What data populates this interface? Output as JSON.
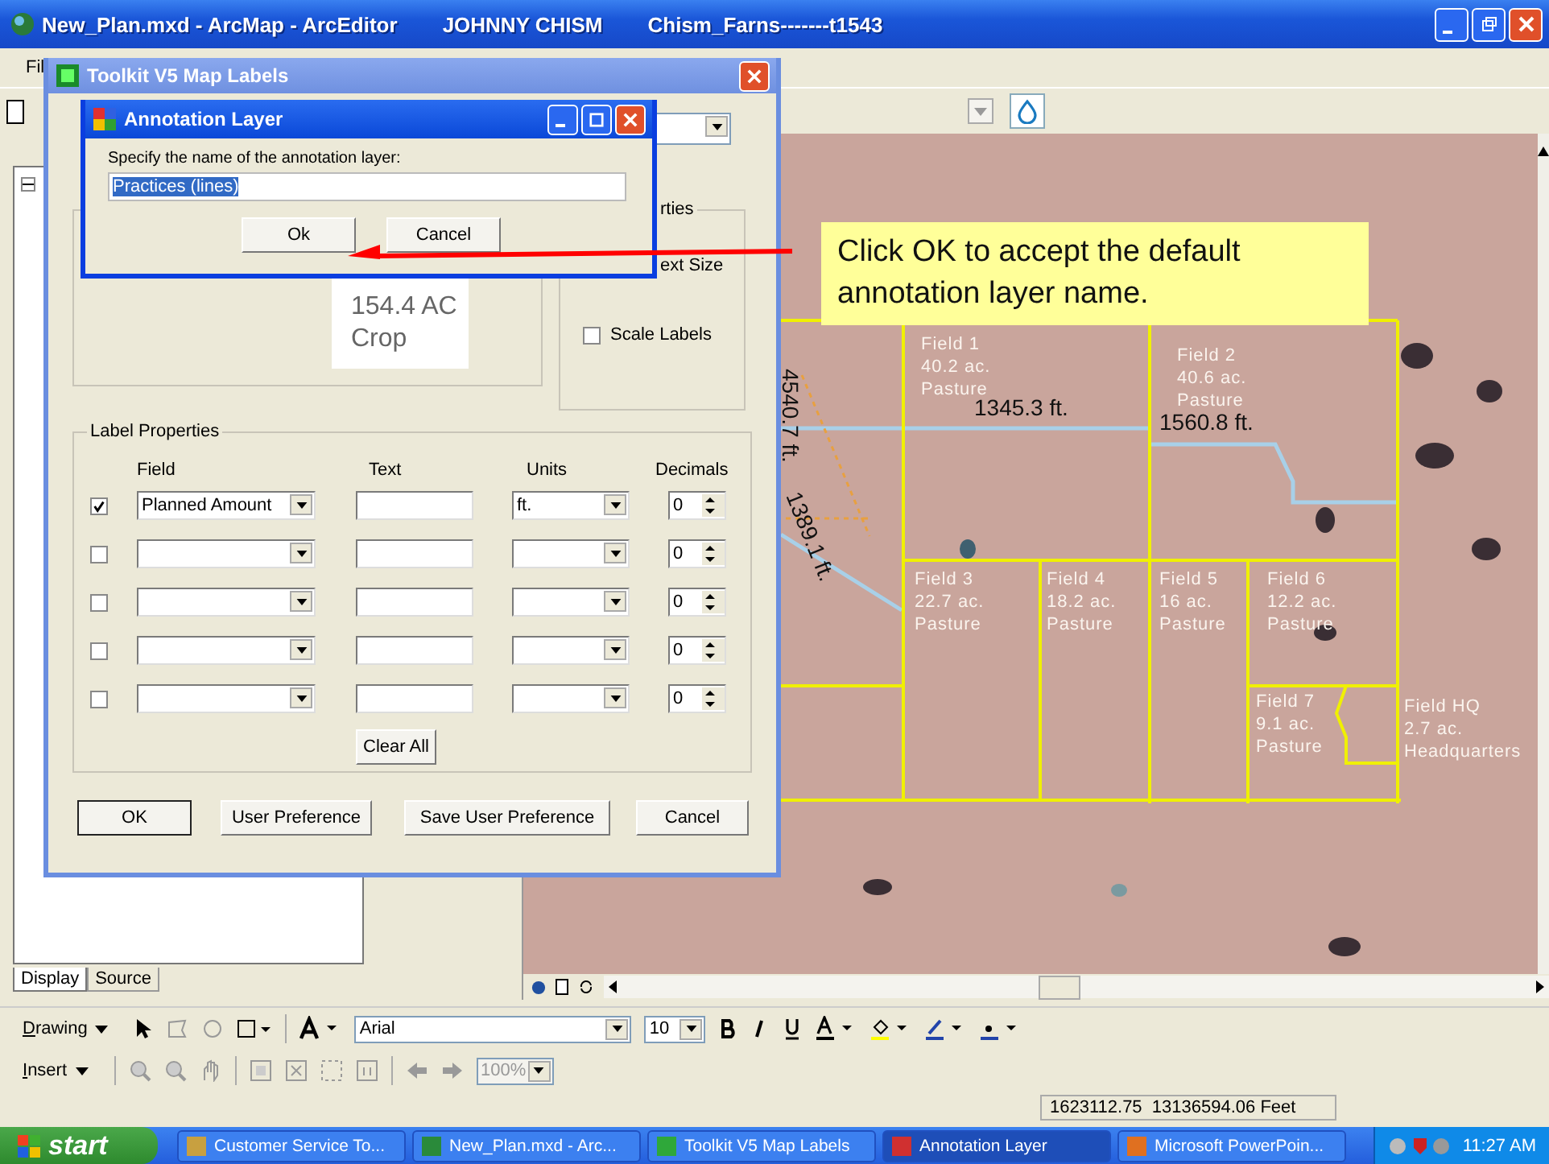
{
  "window": {
    "title": "New_Plan.mxd - ArcMap - ArcEditor",
    "user": "JOHNNY CHISM",
    "document": "Chism_Farns-------t1543"
  },
  "menu_bar": {
    "items": [
      "Fil"
    ]
  },
  "toc": {
    "tabs": [
      {
        "label": "Display",
        "selected": true
      },
      {
        "label": "Source",
        "selected": false
      }
    ]
  },
  "toolkit_dialog": {
    "title": "Toolkit V5 Map Labels",
    "preview": {
      "lines": [
        "154.4 AC",
        "Crop"
      ]
    },
    "properties": {
      "legend": "rties",
      "text_size_label": "ext Size",
      "scale_labels": {
        "label": "Scale Labels",
        "checked": false
      }
    },
    "label_properties": {
      "legend": "Label Properties",
      "columns": [
        "Field",
        "Text",
        "Units",
        "Decimals"
      ],
      "rows": [
        {
          "checked": true,
          "field": "Planned Amount",
          "units": "ft.",
          "decimals": "0"
        },
        {
          "checked": false,
          "decimals": "0"
        },
        {
          "checked": false,
          "decimals": "0"
        },
        {
          "checked": false,
          "decimals": "0"
        },
        {
          "checked": false,
          "decimals": "0"
        }
      ],
      "clear_button": "Clear All"
    },
    "buttons": [
      {
        "label": "OK",
        "default": true
      },
      {
        "label": "User Preference",
        "default": false
      },
      {
        "label": "Save User Preference",
        "default": false
      },
      {
        "label": "Cancel",
        "default": false
      }
    ]
  },
  "annotation_dialog": {
    "title": "Annotation Layer",
    "prompt": "Specify the name of the annotation layer:",
    "value": "Practices (lines)",
    "value_selected": true,
    "buttons": [
      "Ok",
      "Cancel"
    ]
  },
  "callout": {
    "text": "Click OK to accept the default annotation layer name."
  },
  "map": {
    "fields": [
      {
        "name": "Field 1",
        "area": "40.2 ac.",
        "use": "Pasture"
      },
      {
        "name": "Field 2",
        "area": "40.6 ac.",
        "use": "Pasture"
      },
      {
        "name": "Field 3",
        "area": "22.7 ac.",
        "use": "Pasture"
      },
      {
        "name": "Field 4",
        "area": "18.2 ac.",
        "use": "Pasture"
      },
      {
        "name": "Field 5",
        "area": "16 ac.",
        "use": "Pasture"
      },
      {
        "name": "Field 6",
        "area": "12.2 ac.",
        "use": "Pasture"
      },
      {
        "name": "Field 7",
        "area": "9.1 ac.",
        "use": "Pasture"
      },
      {
        "name": "Field HQ",
        "area": "2.7 ac.",
        "use": "Headquarters"
      }
    ],
    "measurements": [
      "1345.3 ft.",
      "1560.8 ft.",
      "4540.7 ft.",
      "1389.1 ft."
    ]
  },
  "drawing_toolbar": {
    "label": "Drawing",
    "font": "Arial",
    "size": "10"
  },
  "insert_toolbar": {
    "label": "Insert",
    "zoom": "100%"
  },
  "status_bar": {
    "coordinates": "1623112.75  13136594.06 Feet"
  },
  "taskbar": {
    "start": "start",
    "tasks": [
      {
        "label": "Customer Service To...",
        "selected": false
      },
      {
        "label": "New_Plan.mxd - Arc...",
        "selected": false
      },
      {
        "label": "Toolkit V5 Map Labels",
        "selected": false
      },
      {
        "label": "Annotation Layer",
        "selected": true
      },
      {
        "label": "Microsoft PowerPoin...",
        "selected": false
      }
    ],
    "clock": "11:27 AM"
  }
}
